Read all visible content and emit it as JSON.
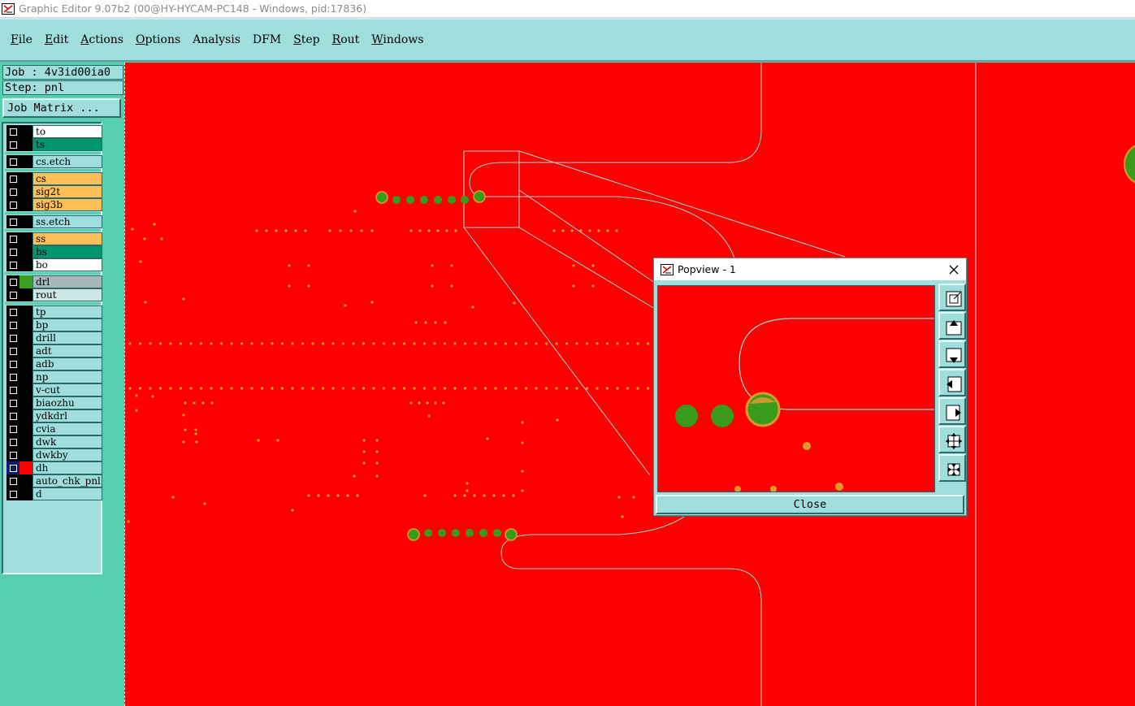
{
  "window": {
    "title": "Graphic Editor 9.07b2 (00@HY-HYCAM-PC148 - Windows, pid:17836)"
  },
  "menu": [
    {
      "label": "File",
      "key": "F",
      "rest": "ile"
    },
    {
      "label": "Edit",
      "key": "E",
      "rest": "dit"
    },
    {
      "label": "Actions",
      "key": "A",
      "rest": "ctions"
    },
    {
      "label": "Options",
      "key": "O",
      "rest": "ptions"
    },
    {
      "label": "Analysis",
      "key": "",
      "rest": "Analysis"
    },
    {
      "label": "DFM",
      "key": "",
      "rest": "DFM"
    },
    {
      "label": "Step",
      "key": "S",
      "rest": "tep"
    },
    {
      "label": "Rout",
      "key": "R",
      "rest": "out"
    },
    {
      "label": "Windows",
      "key": "W",
      "rest": "indows"
    }
  ],
  "job": {
    "job_line": "Job : 4v3id00ia0",
    "step_line": "Step: pnl",
    "matrix_button": "Job Matrix ..."
  },
  "layers": [
    {
      "name": "to",
      "bg": "#ffffff",
      "swatch": "#000000"
    },
    {
      "name": "ts",
      "bg": "#00966e",
      "swatch": "#000000"
    },
    {
      "name": "cs.etch",
      "bg": "#a0dede",
      "swatch": "#000000"
    },
    {
      "name": "cs",
      "bg": "#ffc05a",
      "swatch": "#000000"
    },
    {
      "name": "sig2t",
      "bg": "#ffc05a",
      "swatch": "#000000"
    },
    {
      "name": "sig3b",
      "bg": "#ffc05a",
      "swatch": "#000000"
    },
    {
      "name": "ss.etch",
      "bg": "#a0dede",
      "swatch": "#000000"
    },
    {
      "name": "ss",
      "bg": "#ffc05a",
      "swatch": "#000000"
    },
    {
      "name": "bs",
      "bg": "#00966e",
      "swatch": "#000000"
    },
    {
      "name": "bo",
      "bg": "#ffffff",
      "swatch": "#000000"
    },
    {
      "name": "drl",
      "bg": "#a8b8b8",
      "swatch": "#3aa01e"
    },
    {
      "name": "rout",
      "bg": "#cfe6e6",
      "swatch": "#000000"
    },
    {
      "name": "tp",
      "bg": "#a0dede",
      "swatch": "#000000"
    },
    {
      "name": "bp",
      "bg": "#a0dede",
      "swatch": "#000000"
    },
    {
      "name": "drill",
      "bg": "#a0dede",
      "swatch": "#000000"
    },
    {
      "name": "adt",
      "bg": "#a0dede",
      "swatch": "#000000"
    },
    {
      "name": "adb",
      "bg": "#a0dede",
      "swatch": "#000000"
    },
    {
      "name": "np",
      "bg": "#a0dede",
      "swatch": "#000000"
    },
    {
      "name": "v-cut",
      "bg": "#a0dede",
      "swatch": "#000000"
    },
    {
      "name": "biaozhu",
      "bg": "#a0dede",
      "swatch": "#000000"
    },
    {
      "name": "ydkdrl",
      "bg": "#a0dede",
      "swatch": "#000000"
    },
    {
      "name": "cvia",
      "bg": "#a0dede",
      "swatch": "#000000"
    },
    {
      "name": "dwk",
      "bg": "#a0dede",
      "swatch": "#000000"
    },
    {
      "name": "dwkby",
      "bg": "#a0dede",
      "swatch": "#000000"
    },
    {
      "name": "dh",
      "bg": "#a0dede",
      "swatch": "#ff0000",
      "active": true
    },
    {
      "name": "auto_chk_pnl",
      "bg": "#a0dede",
      "swatch": "#000000"
    },
    {
      "name": "d",
      "bg": "#a0dede",
      "swatch": "#000000"
    }
  ],
  "popview": {
    "title": "Popview - 1",
    "close_label": "Close",
    "tools": [
      "zoom-fit-icon",
      "pan-up-icon",
      "pan-down-icon",
      "pan-left-icon",
      "pan-right-icon",
      "zoom-in-icon",
      "zoom-out-icon"
    ]
  },
  "colors": {
    "canvas": "#ff0000",
    "pad_green": "#3a9a1a",
    "pad_orange": "#e09a2a",
    "outline": "#9ed4d4"
  }
}
